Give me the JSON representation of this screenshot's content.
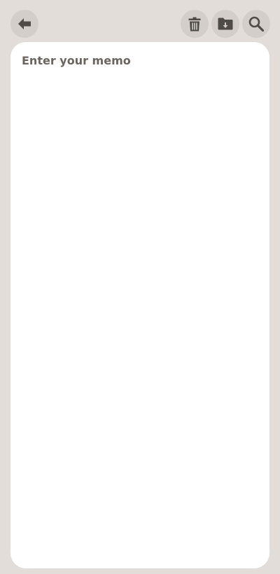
{
  "toolbar": {
    "back_icon": "arrow-left-icon",
    "delete_icon": "trash-icon",
    "folder_icon": "folder-download-icon",
    "search_icon": "search-icon"
  },
  "memo": {
    "value": "",
    "placeholder": "Enter your memo"
  },
  "colors": {
    "background": "#e2ddd8",
    "button_bg": "#d3cec9",
    "icon": "#4f4b47",
    "card": "#ffffff",
    "placeholder": "#6b6560"
  }
}
